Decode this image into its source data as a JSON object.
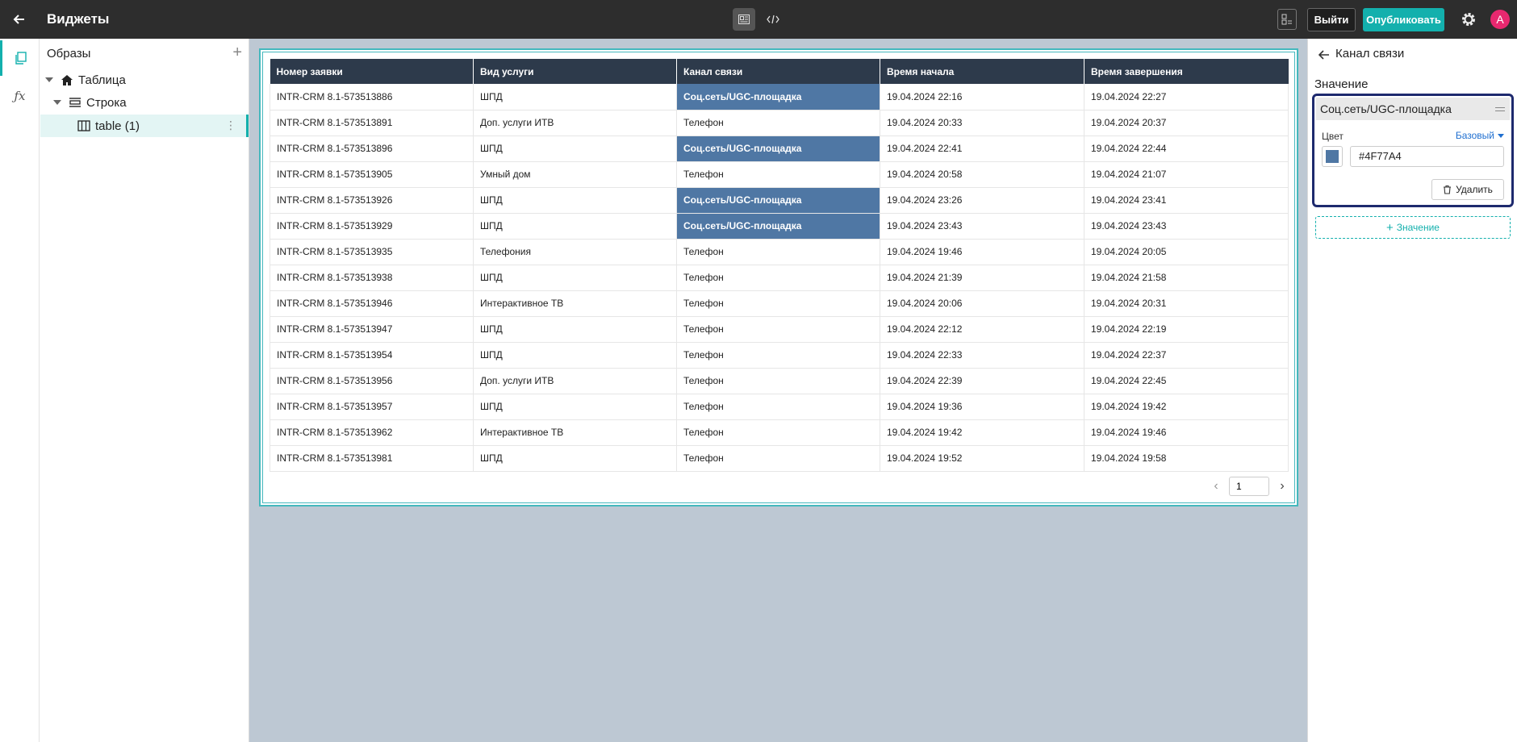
{
  "topbar": {
    "title": "Виджеты",
    "icons": [
      "arrow-left-icon",
      "layout-icon",
      "code-icon",
      "preview-icon",
      "gear-icon"
    ],
    "exit_label": "Выйти",
    "publish_label": "Опубликовать",
    "avatar_initial": "A",
    "colors": {
      "background": "#2d2d2d",
      "publish": "#13b0ad",
      "avatar": "#e8286f"
    }
  },
  "rail": {
    "icons": [
      "pages-icon",
      "function-icon"
    ],
    "fx_label": "ƒx"
  },
  "tree": {
    "header": "Образы",
    "add_label": "+",
    "items": [
      {
        "label": "Таблица",
        "icon": "home-icon"
      },
      {
        "label": "Строка",
        "icon": "row-icon"
      },
      {
        "label": "table (1)",
        "icon": "table-icon"
      }
    ]
  },
  "table": {
    "columns": [
      "Номер заявки",
      "Вид услуги",
      "Канал связи",
      "Время начала",
      "Время завершения"
    ],
    "highlight_value": "Соц.сеть/UGC-площадка",
    "highlight_color": "#4F77A4",
    "header_color": "#2d3a4b",
    "rows": [
      [
        "INTR-CRM 8.1-573513886",
        "ШПД",
        "Соц.сеть/UGC-площадка",
        "19.04.2024 22:16",
        "19.04.2024 22:27"
      ],
      [
        "INTR-CRM 8.1-573513891",
        "Доп. услуги ИТВ",
        "Телефон",
        "19.04.2024 20:33",
        "19.04.2024 20:37"
      ],
      [
        "INTR-CRM 8.1-573513896",
        "ШПД",
        "Соц.сеть/UGC-площадка",
        "19.04.2024 22:41",
        "19.04.2024 22:44"
      ],
      [
        "INTR-CRM 8.1-573513905",
        "Умный дом",
        "Телефон",
        "19.04.2024 20:58",
        "19.04.2024 21:07"
      ],
      [
        "INTR-CRM 8.1-573513926",
        "ШПД",
        "Соц.сеть/UGC-площадка",
        "19.04.2024 23:26",
        "19.04.2024 23:41"
      ],
      [
        "INTR-CRM 8.1-573513929",
        "ШПД",
        "Соц.сеть/UGC-площадка",
        "19.04.2024 23:43",
        "19.04.2024 23:43"
      ],
      [
        "INTR-CRM 8.1-573513935",
        "Телефония",
        "Телефон",
        "19.04.2024 19:46",
        "19.04.2024 20:05"
      ],
      [
        "INTR-CRM 8.1-573513938",
        "ШПД",
        "Телефон",
        "19.04.2024 21:39",
        "19.04.2024 21:58"
      ],
      [
        "INTR-CRM 8.1-573513946",
        "Интерактивное ТВ",
        "Телефон",
        "19.04.2024 20:06",
        "19.04.2024 20:31"
      ],
      [
        "INTR-CRM 8.1-573513947",
        "ШПД",
        "Телефон",
        "19.04.2024 22:12",
        "19.04.2024 22:19"
      ],
      [
        "INTR-CRM 8.1-573513954",
        "ШПД",
        "Телефон",
        "19.04.2024 22:33",
        "19.04.2024 22:37"
      ],
      [
        "INTR-CRM 8.1-573513956",
        "Доп. услуги ИТВ",
        "Телефон",
        "19.04.2024 22:39",
        "19.04.2024 22:45"
      ],
      [
        "INTR-CRM 8.1-573513957",
        "ШПД",
        "Телефон",
        "19.04.2024 19:36",
        "19.04.2024 19:42"
      ],
      [
        "INTR-CRM 8.1-573513962",
        "Интерактивное ТВ",
        "Телефон",
        "19.04.2024 19:42",
        "19.04.2024 19:46"
      ],
      [
        "INTR-CRM 8.1-573513981",
        "ШПД",
        "Телефон",
        "19.04.2024 19:52",
        "19.04.2024 19:58"
      ]
    ],
    "pagination": {
      "page": "1",
      "prev_label": "‹",
      "next_label": "›"
    }
  },
  "right_panel": {
    "title": "Канал связи",
    "value_label": "Значение",
    "value_card": {
      "value": "Соц.сеть/UGC-площадка",
      "color_label": "Цвет",
      "color_mode": "Базовый",
      "color_hex": "#4F77A4",
      "delete_label": "Удалить"
    },
    "add_value_label": "Значение",
    "add_value_plus": "+"
  }
}
